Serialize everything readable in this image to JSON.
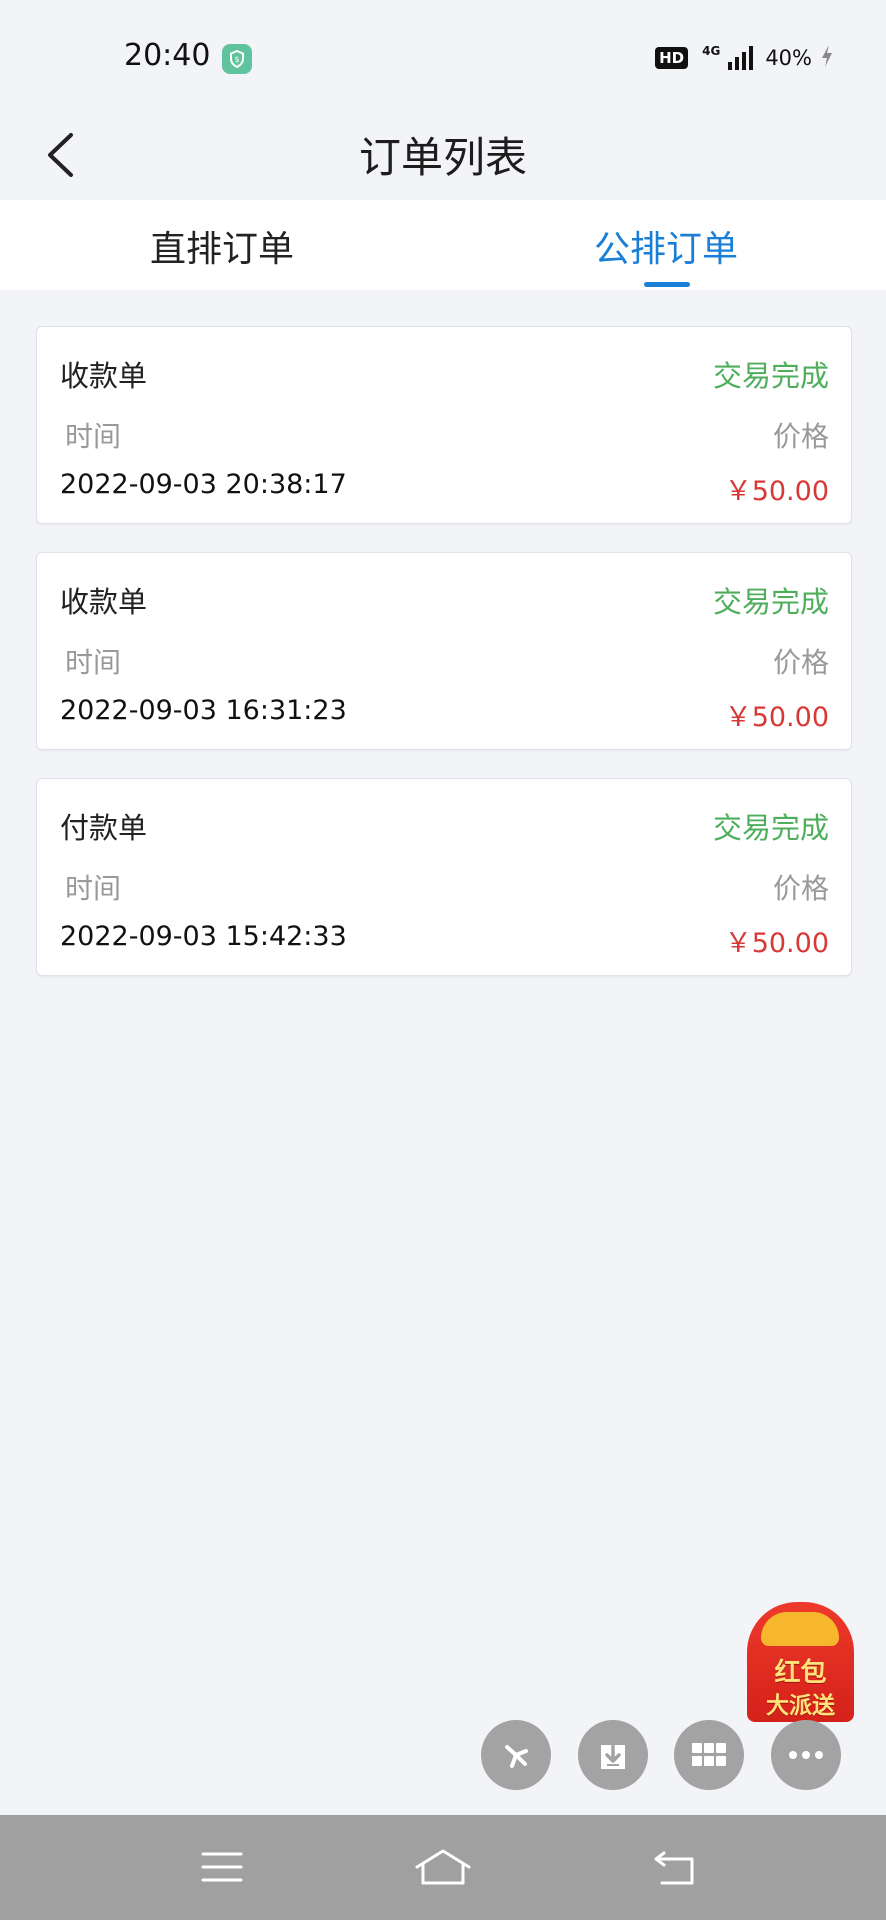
{
  "status_bar": {
    "time": "20:40",
    "hd": "HD",
    "network": "4G",
    "battery": "40%"
  },
  "header": {
    "title": "订单列表"
  },
  "tabs": [
    {
      "label": "直排订单",
      "active": false
    },
    {
      "label": "公排订单",
      "active": true
    }
  ],
  "orders": [
    {
      "type": "收款单",
      "status": "交易完成",
      "time_label": "时间",
      "price_label": "价格",
      "time": "2022-09-03 20:38:17",
      "price": "￥50.00"
    },
    {
      "type": "收款单",
      "status": "交易完成",
      "time_label": "时间",
      "price_label": "价格",
      "time": "2022-09-03 16:31:23",
      "price": "￥50.00"
    },
    {
      "type": "付款单",
      "status": "交易完成",
      "time_label": "时间",
      "price_label": "价格",
      "time": "2022-09-03 15:42:33",
      "price": "￥50.00"
    }
  ],
  "promo": {
    "line1": "红包",
    "line2": "大派送"
  },
  "floating_buttons": [
    "pinwheel-icon",
    "download-icon",
    "grid-icon",
    "more-icon"
  ],
  "nav": [
    "menu-icon",
    "home-icon",
    "back-icon"
  ],
  "colors": {
    "accent": "#1a7fd6",
    "status_green": "#4fae5c",
    "price_red": "#d73a36"
  }
}
